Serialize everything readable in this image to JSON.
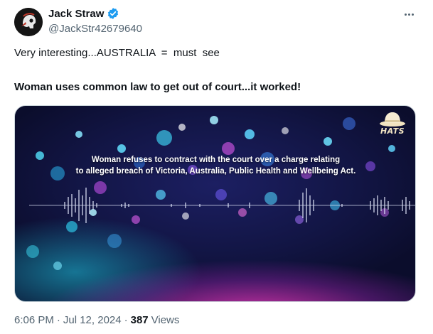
{
  "author": {
    "display_name": "Jack Straw",
    "handle": "@JackStr42679640",
    "verified_color": "#1d9bf0"
  },
  "tweet": {
    "text_line1": "Very interesting...AUSTRALIA  =  must  see",
    "text_line2": "Woman uses common law to get out of court...it worked!"
  },
  "media": {
    "caption_line1": "Woman refuses to contract with the court over a charge relating",
    "caption_line2": "to alleged breach of Victoria, Australia, Public Health and Wellbeing Act.",
    "watermark": "HATS"
  },
  "footer": {
    "time": "6:06 PM",
    "separator": "·",
    "date": "Jul 12, 2024",
    "views_count": "387",
    "views_label": "Views"
  },
  "icons": {
    "more": "more-horizontal-icon",
    "verified": "verified-badge-icon"
  }
}
